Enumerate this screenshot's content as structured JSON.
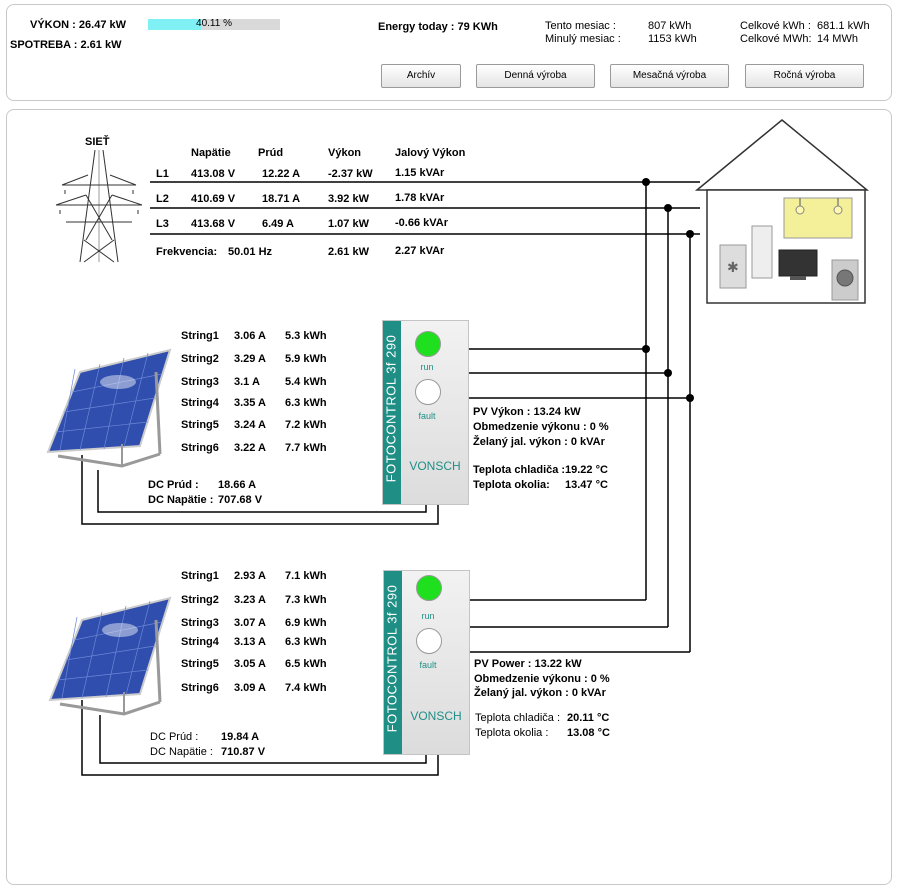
{
  "header": {
    "vykon_label": "VÝKON :",
    "vykon_value": "26.47 kW",
    "spotreba_label": "SPOTREBA :",
    "spotreba_value": "2.61 kW",
    "progress_text": "40.11 %",
    "progress_fraction": 0.4011,
    "energy_today": "Energy today : 79 KWh",
    "stats": {
      "tento_label": "Tento mesiac :",
      "tento_value": "807 kWh",
      "minuly_label": "Minulý mesiac :",
      "minuly_value": "1153 kWh",
      "celk_kwh_label": "Celkové kWh :",
      "celk_kwh_value": "681.1 kWh",
      "celk_mwh_label": "Celkové MWh:",
      "celk_mwh_value": "14 MWh"
    },
    "buttons": [
      "Archív",
      "Denná výroba",
      "Mesačná výroba",
      "Ročná výroba"
    ]
  },
  "grid": {
    "title": "SIEŤ",
    "columns": [
      "Napätie",
      "Prúd",
      "Výkon",
      "Jalový Výkon"
    ],
    "rows": [
      {
        "phase": "L1",
        "voltage": "413.08 V",
        "current": "12.22 A",
        "power": "-2.37 kW",
        "reactive": "1.15 kVAr"
      },
      {
        "phase": "L2",
        "voltage": "410.69 V",
        "current": "18.71 A",
        "power": "3.92 kW",
        "reactive": "1.78 kVAr"
      },
      {
        "phase": "L3",
        "voltage": "413.68 V",
        "current": "6.49 A",
        "power": "1.07 kW",
        "reactive": "-0.66 kVAr"
      }
    ],
    "freq_label": "Frekvencia:",
    "freq_value": "50.01 Hz",
    "total_power": "2.61 kW",
    "total_reactive": "2.27 kVAr"
  },
  "inverters": [
    {
      "strings": [
        {
          "name": "String1",
          "current": "3.06 A",
          "energy": "5.3 kWh"
        },
        {
          "name": "String2",
          "current": "3.29 A",
          "energy": "5.9 kWh"
        },
        {
          "name": "String3",
          "current": "3.1 A",
          "energy": "5.4 kWh"
        },
        {
          "name": "String4",
          "current": "3.35 A",
          "energy": "6.3 kWh"
        },
        {
          "name": "String5",
          "current": "3.24 A",
          "energy": "7.2 kWh"
        },
        {
          "name": "String6",
          "current": "3.22 A",
          "energy": "7.7 kWh"
        }
      ],
      "dc_prud_label": "DC Prúd :",
      "dc_prud_value": "18.66 A",
      "dc_napatie_label": "DC Napätie :",
      "dc_napatie_value": "707.68 V",
      "device_text": "FOTOCONTROL 3f 290",
      "brand": "VONSCH",
      "run_label": "run",
      "fault_label": "fault",
      "pv_power": "PV Výkon : 13.24 kW",
      "obmedzenie": "Obmedzenie výkonu : 0 %",
      "zelany": "Želaný jal. výkon : 0 kVAr",
      "teplota_chl_label": "Teplota chladiča :",
      "teplota_chl_value": "19.22 °C",
      "teplota_ok_label": "Teplota okolia:",
      "teplota_ok_value": "13.47 °C"
    },
    {
      "strings": [
        {
          "name": "String1",
          "current": "2.93 A",
          "energy": "7.1 kWh"
        },
        {
          "name": "String2",
          "current": "3.23 A",
          "energy": "7.3 kWh"
        },
        {
          "name": "String3",
          "current": "3.07 A",
          "energy": "6.9 kWh"
        },
        {
          "name": "String4",
          "current": "3.13 A",
          "energy": "6.3 kWh"
        },
        {
          "name": "String5",
          "current": "3.05 A",
          "energy": "6.5 kWh"
        },
        {
          "name": "String6",
          "current": "3.09 A",
          "energy": "7.4 kWh"
        }
      ],
      "dc_prud_label": "DC Prúd :",
      "dc_prud_value": "19.84 A",
      "dc_napatie_label": "DC Napätie :",
      "dc_napatie_value": "710.87 V",
      "device_text": "FOTOCONTROL 3f 290",
      "brand": "VONSCH",
      "run_label": "run",
      "fault_label": "fault",
      "pv_power": "PV Power : 13.22 kW",
      "obmedzenie": "Obmedzenie výkonu : 0 %",
      "zelany": "Želaný jal. výkon : 0 kVAr",
      "teplota_chl_label": "Teplota chladiča :",
      "teplota_chl_value": "20.11 °C",
      "teplota_ok_label": "Teplota okolia :",
      "teplota_ok_value": "13.08 °C"
    }
  ],
  "colors": {
    "run_led": "#1fe01f",
    "teal": "#1f8f86",
    "progress": "#7ff0f4"
  }
}
